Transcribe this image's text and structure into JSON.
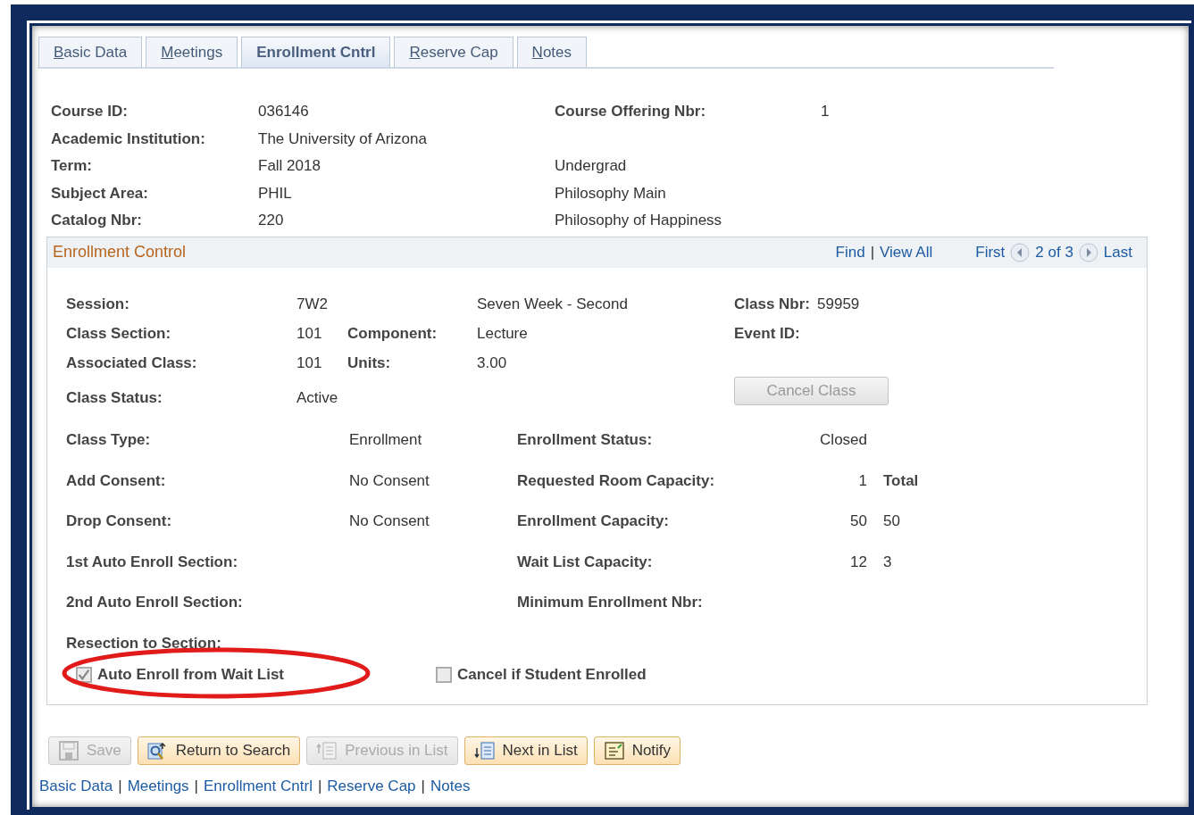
{
  "tabs": [
    {
      "label": "Basic Data",
      "selected": false,
      "shortcut_underlined": true
    },
    {
      "label": "Meetings",
      "selected": false,
      "shortcut_underlined": true
    },
    {
      "label": "Enrollment Cntrl",
      "selected": true,
      "shortcut_underlined": false
    },
    {
      "label": "Reserve Cap",
      "selected": false,
      "shortcut_underlined": true
    },
    {
      "label": "Notes",
      "selected": false,
      "shortcut_underlined": true
    }
  ],
  "course_header": [
    {
      "label": "Course ID:",
      "value": "036146",
      "column_3": "Course Offering Nbr:",
      "column_4": "1"
    },
    {
      "label": "Academic Institution:",
      "value": "The University of Arizona"
    },
    {
      "label": "Term:",
      "value": "Fall 2018",
      "column_3_value": "Undergrad"
    },
    {
      "label": "Subject Area:",
      "value": "PHIL",
      "column_3_value": "Philosophy Main"
    },
    {
      "label": "Catalog Nbr:",
      "value": "220",
      "column_3_value": "Philosophy of Happiness"
    }
  ],
  "enrollment_control": {
    "title": "Enrollment Control",
    "nav": {
      "find": "Find",
      "separator": "|",
      "view_all": "View All",
      "first": "First",
      "position": "2 of 3",
      "last": "Last"
    },
    "session": {
      "label": "Session:",
      "value": "7W2",
      "description": "Seven Week - Second"
    },
    "class_nbr": {
      "label": "Class Nbr:",
      "value": "59959"
    },
    "class_section": {
      "label": "Class Section:",
      "value": "101"
    },
    "component": {
      "label": "Component:",
      "value": "Lecture"
    },
    "event_id": {
      "label": "Event ID:"
    },
    "associated_class": {
      "label": "Associated Class:",
      "value": "101"
    },
    "units": {
      "label": "Units:",
      "value": "3.00"
    },
    "class_status": {
      "label": "Class Status:",
      "value": "Active"
    },
    "cancel_class_button": {
      "label": "Cancel Class",
      "disabled": true
    },
    "left_fields": [
      {
        "label": "Class Type:",
        "value": "Enrollment"
      },
      {
        "label": "Add Consent:",
        "value": "No Consent"
      },
      {
        "label": "Drop Consent:",
        "value": "No Consent"
      },
      {
        "label": "1st Auto Enroll Section:"
      },
      {
        "label": "2nd Auto Enroll Section:"
      },
      {
        "label": "Resection to Section:"
      }
    ],
    "right_fields": [
      {
        "label": "Enrollment Status:",
        "value": "Closed"
      },
      {
        "label": "Requested Room Capacity:",
        "value": "1",
        "total": "Total",
        "kind": "heading"
      },
      {
        "label": "Enrollment Capacity:",
        "value": "50",
        "total": "50",
        "kind": "value"
      },
      {
        "label": "Wait List Capacity:",
        "value": "12",
        "total": "3",
        "kind": "value"
      },
      {
        "label": "Minimum Enrollment Nbr:"
      }
    ],
    "checkboxes": [
      {
        "label": "Auto Enroll from Wait List",
        "checked": true,
        "disabled": true,
        "highlighted": true
      },
      {
        "label": "Cancel if Student Enrolled",
        "checked": false,
        "disabled": true,
        "highlighted": false
      }
    ]
  },
  "buttons": [
    {
      "label": "Save",
      "kind": "save",
      "disabled": true
    },
    {
      "label": "Return to Search",
      "kind": "search",
      "disabled": false
    },
    {
      "label": "Previous in List",
      "kind": "previous",
      "disabled": true
    },
    {
      "label": "Next in List",
      "kind": "next",
      "disabled": false
    },
    {
      "label": "Notify",
      "kind": "notify",
      "disabled": false
    }
  ],
  "bottom_links": [
    "Basic Data",
    "Meetings",
    "Enrollment Cntrl",
    "Reserve Cap",
    "Notes"
  ],
  "bottom_link_separator": "|"
}
